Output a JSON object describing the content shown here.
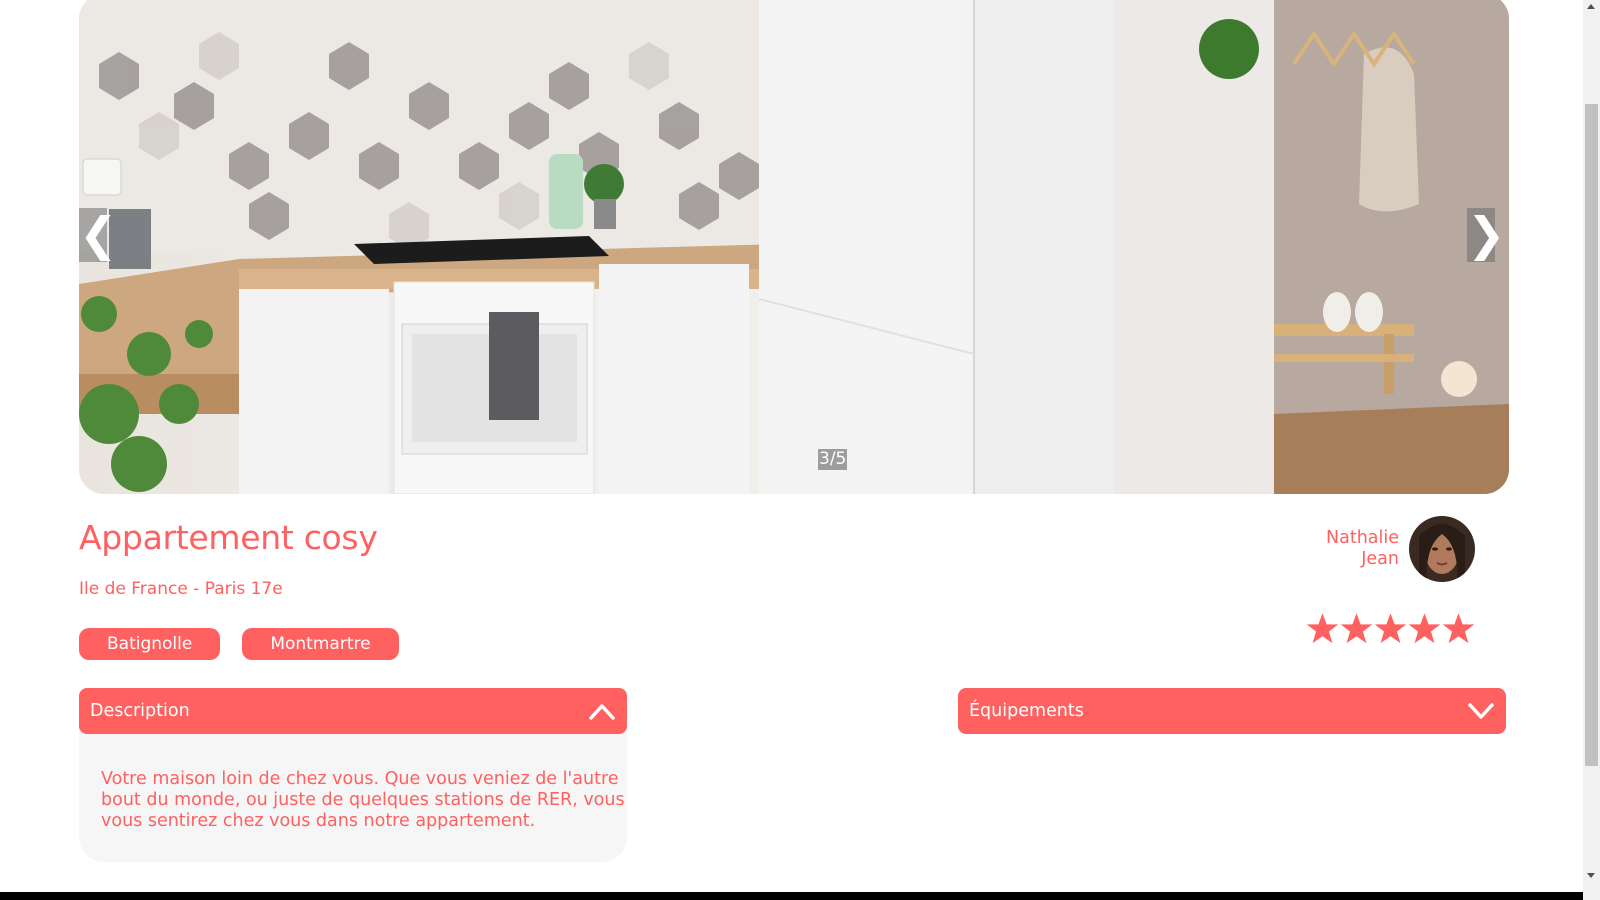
{
  "gallery": {
    "prev_symbol": "❮",
    "next_symbol": "❯",
    "counter": "3/5",
    "image_alt": "Appartement cosy"
  },
  "listing": {
    "title": "Appartement cosy",
    "location": "Ile de France - Paris 17e",
    "tags": [
      "Batignolle",
      "Montmartre"
    ]
  },
  "host": {
    "first_name": "Nathalie",
    "last_name": "Jean"
  },
  "rating": {
    "value": 5,
    "max": 5
  },
  "collapses": {
    "description": {
      "title": "Description",
      "state": "open",
      "body": "Votre maison loin de chez vous. Que vous veniez de l'autre bout du monde, ou juste de quelques stations de RER, vous vous sentirez chez vous dans notre appartement."
    },
    "equipements": {
      "title": "Équipements",
      "state": "closed"
    }
  },
  "colors": {
    "accent": "#FF6060",
    "panel": "#F6F6F6"
  }
}
